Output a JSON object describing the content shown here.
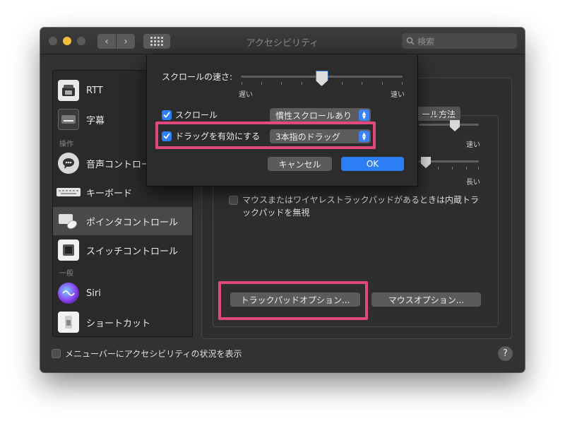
{
  "window": {
    "title": "アクセシビリティ"
  },
  "search": {
    "placeholder": "検索"
  },
  "sidebar": {
    "items": [
      {
        "label": "RTT"
      },
      {
        "label": "字幕"
      },
      {
        "label": "音声コントロール"
      },
      {
        "label": "キーボード"
      },
      {
        "label": "ポインタコントロール"
      },
      {
        "label": "スイッチコントロール"
      },
      {
        "label": "Siri"
      },
      {
        "label": "ショートカット"
      }
    ],
    "headers": {
      "operation": "操作",
      "general": "一般"
    }
  },
  "panel": {
    "tab_partial": "ール方法",
    "speed_fast": "速い",
    "speed_long": "長い",
    "ignore_trackpad": "マウスまたはワイヤレストラックパッドがあるときは内蔵トラックパッドを無視",
    "trackpad_options_button": "トラックパッドオプション...",
    "mouse_options_button": "マウスオプション..."
  },
  "footer": {
    "show_status_label": "メニューバーにアクセシビリティの状況を表示",
    "help": "?"
  },
  "sheet": {
    "scroll_speed_label": "スクロールの速さ:",
    "slow": "遅い",
    "fast": "速い",
    "scroll_speed_value": 0.5,
    "scroll": {
      "label": "スクロール",
      "checked": true,
      "option": "慣性スクロールあり"
    },
    "drag": {
      "label": "ドラッグを有効にする",
      "checked": true,
      "option": "3本指のドラッグ"
    },
    "cancel": "キャンセル",
    "ok": "OK"
  },
  "colors": {
    "highlight": "#e0487f",
    "accent": "#2b7ef3"
  }
}
